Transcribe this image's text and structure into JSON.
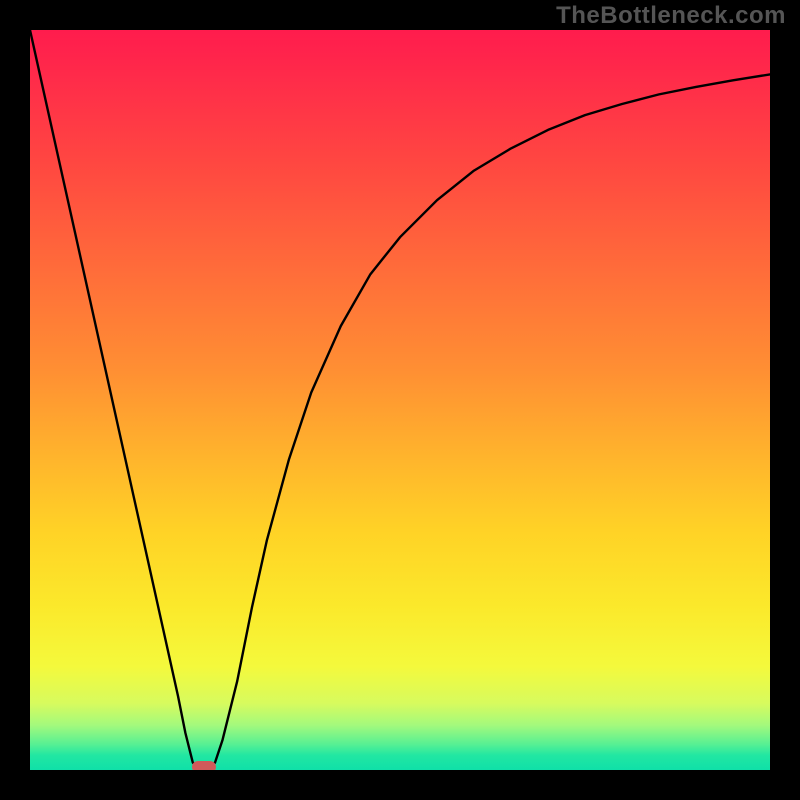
{
  "watermark": "TheBottleneck.com",
  "chart_data": {
    "type": "line",
    "title": "",
    "xlabel": "",
    "ylabel": "",
    "xlim": [
      0,
      100
    ],
    "ylim": [
      0,
      100
    ],
    "x": [
      0,
      2,
      4,
      6,
      8,
      10,
      12,
      14,
      16,
      18,
      20,
      21,
      22,
      23,
      24,
      25,
      26,
      28,
      30,
      32,
      35,
      38,
      42,
      46,
      50,
      55,
      60,
      65,
      70,
      75,
      80,
      85,
      90,
      95,
      100
    ],
    "y": [
      100,
      91,
      82,
      73,
      64,
      55,
      46,
      37,
      28,
      19,
      10,
      5,
      1,
      0,
      0,
      1,
      4,
      12,
      22,
      31,
      42,
      51,
      60,
      67,
      72,
      77,
      81,
      84,
      86.5,
      88.5,
      90,
      91.3,
      92.3,
      93.2,
      94
    ],
    "gradient_bands": [
      {
        "y": 100,
        "color": "#ff1c4d"
      },
      {
        "y": 50,
        "color": "#ffb52c"
      },
      {
        "y": 20,
        "color": "#fbe92b"
      },
      {
        "y": 5,
        "color": "#58f093"
      },
      {
        "y": 0,
        "color": "#0fe0a8"
      }
    ],
    "marker": {
      "x": 23.5,
      "y": 0,
      "width": 3.2,
      "height": 1.6,
      "color": "#d15a5a"
    }
  }
}
